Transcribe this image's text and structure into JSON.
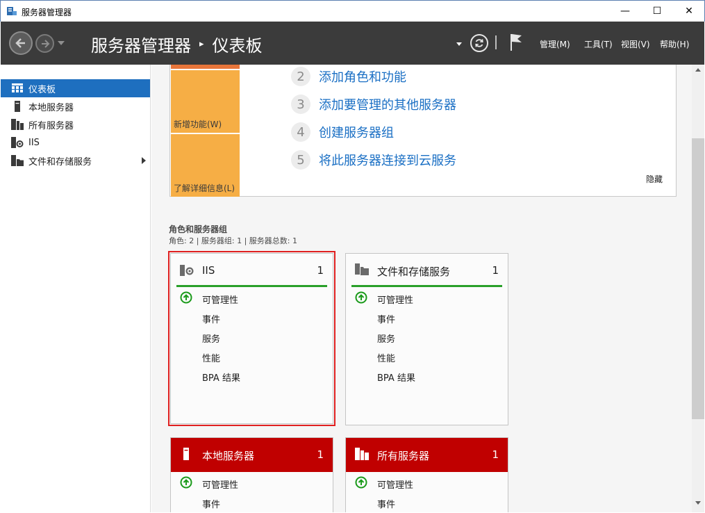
{
  "window": {
    "title": "服务器管理器",
    "min_glyph": "—",
    "max_glyph": "☐",
    "close_glyph": "✕"
  },
  "header": {
    "breadcrumb_root": "服务器管理器",
    "breadcrumb_sep": "▸",
    "breadcrumb_current": "仪表板",
    "menus": [
      {
        "label": "管理(M)"
      },
      {
        "label": "工具(T)"
      },
      {
        "label": "视图(V)"
      },
      {
        "label": "帮助(H)"
      }
    ]
  },
  "sidebar": {
    "items": [
      {
        "label": "仪表板",
        "icon": "dashboard-icon",
        "selected": true
      },
      {
        "label": "本地服务器",
        "icon": "server-icon"
      },
      {
        "label": "所有服务器",
        "icon": "servers-icon"
      },
      {
        "label": "IIS",
        "icon": "iis-icon"
      },
      {
        "label": "文件和存储服务",
        "icon": "folder-storage-icon",
        "expandable": true
      }
    ]
  },
  "welcome": {
    "whats_new": "新增功能(W)",
    "learn_more": "了解详细信息(L)",
    "steps": [
      {
        "num": "2",
        "label": "添加角色和功能"
      },
      {
        "num": "3",
        "label": "添加要管理的其他服务器"
      },
      {
        "num": "4",
        "label": "创建服务器组"
      },
      {
        "num": "5",
        "label": "将此服务器连接到云服务"
      }
    ],
    "hide": "隐藏"
  },
  "roles": {
    "title": "角色和服务器组",
    "subtitle": "角色: 2 | 服务器组: 1 | 服务器总数: 1",
    "tiles": [
      {
        "name": "IIS",
        "count": "1",
        "rows": [
          "可管理性",
          "事件",
          "服务",
          "性能",
          "BPA 结果"
        ]
      },
      {
        "name": "文件和存储服务",
        "count": "1",
        "rows": [
          "可管理性",
          "事件",
          "服务",
          "性能",
          "BPA 结果"
        ]
      },
      {
        "name": "本地服务器",
        "count": "1",
        "rows": [
          "可管理性",
          "事件"
        ]
      },
      {
        "name": "所有服务器",
        "count": "1",
        "rows": [
          "可管理性",
          "事件"
        ]
      }
    ]
  },
  "colors": {
    "accent": "#1e6fbf",
    "header_bg": "#3b3b3b",
    "tile_ok": "#2aa02a",
    "tile_alert": "#c00000",
    "orange": "#f6ae45"
  }
}
